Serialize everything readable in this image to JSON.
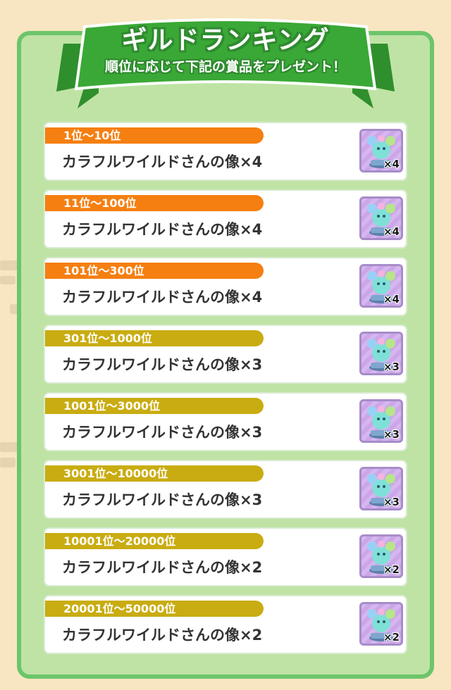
{
  "banner": {
    "title": "ギルドランキング",
    "subtitle": "順位に応じて下記の賞品をプレゼント！"
  },
  "colors": {
    "rank_orange": "#f57f10",
    "rank_gold": "#c9ac11",
    "panel_green": "#bfe3a5",
    "banner_green": "#3aa836"
  },
  "rewards": [
    {
      "rank": "1位～10位",
      "item": "カラフルワイルドさんの像×4",
      "qty": "×4",
      "tier": "orange",
      "icon": "statue-icon"
    },
    {
      "rank": "11位～100位",
      "item": "カラフルワイルドさんの像×4",
      "qty": "×4",
      "tier": "orange",
      "icon": "statue-icon"
    },
    {
      "rank": "101位～300位",
      "item": "カラフルワイルドさんの像×4",
      "qty": "×4",
      "tier": "orange",
      "icon": "statue-icon"
    },
    {
      "rank": "301位～1000位",
      "item": "カラフルワイルドさんの像×3",
      "qty": "×3",
      "tier": "gold",
      "icon": "statue-icon"
    },
    {
      "rank": "1001位～3000位",
      "item": "カラフルワイルドさんの像×3",
      "qty": "×3",
      "tier": "gold",
      "icon": "statue-icon"
    },
    {
      "rank": "3001位～10000位",
      "item": "カラフルワイルドさんの像×3",
      "qty": "×3",
      "tier": "gold",
      "icon": "statue-icon"
    },
    {
      "rank": "10001位～20000位",
      "item": "カラフルワイルドさんの像×2",
      "qty": "×2",
      "tier": "gold",
      "icon": "statue-icon"
    },
    {
      "rank": "20001位～50000位",
      "item": "カラフルワイルドさんの像×2",
      "qty": "×2",
      "tier": "gold",
      "icon": "statue-icon"
    }
  ]
}
